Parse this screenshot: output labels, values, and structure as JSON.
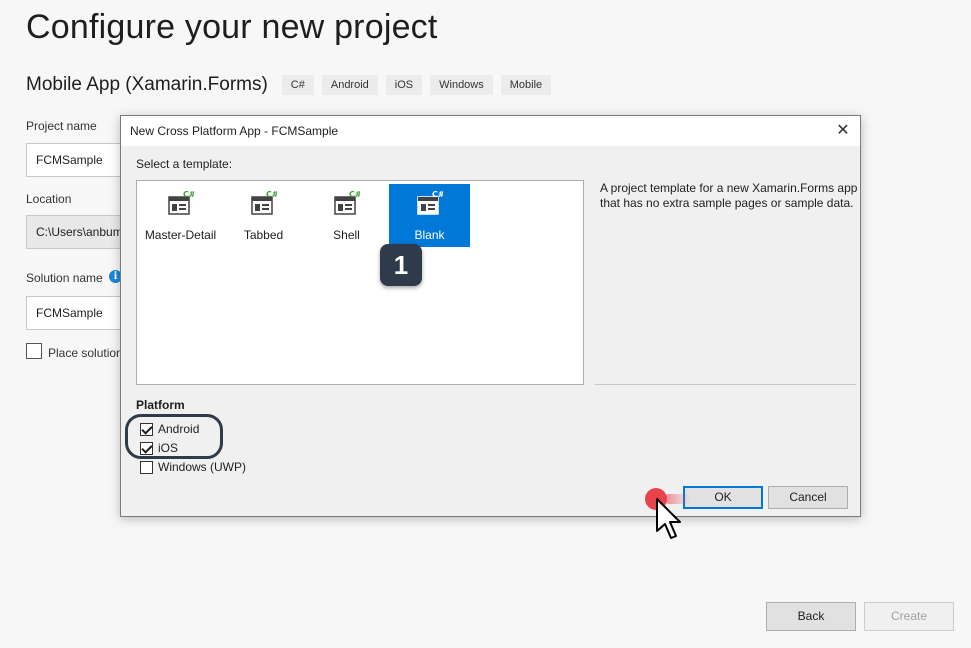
{
  "page": {
    "title": "Configure your new project",
    "subtitle": "Mobile App (Xamarin.Forms)",
    "tags": [
      "C#",
      "Android",
      "iOS",
      "Windows",
      "Mobile"
    ],
    "project_name_label": "Project name",
    "project_name_value": "FCMSample",
    "location_label": "Location",
    "location_value": "C:\\Users\\anbum",
    "solution_name_label": "Solution name",
    "solution_name_value": "FCMSample",
    "info_icon": "i",
    "place_solution_label": "Place solution",
    "back_label": "Back",
    "create_label": "Create"
  },
  "dialog": {
    "title": "New Cross Platform App - FCMSample",
    "close_glyph": "✕",
    "select_template_label": "Select a template:",
    "templates": [
      {
        "label": "Master-Detail",
        "selected": false
      },
      {
        "label": "Tabbed",
        "selected": false
      },
      {
        "label": "Shell",
        "selected": false
      },
      {
        "label": "Blank",
        "selected": true
      }
    ],
    "description": "A project template for a new Xamarin.Forms app that has no extra sample pages or sample data.",
    "platform_heading": "Platform",
    "platforms": [
      {
        "label": "Android",
        "checked": true
      },
      {
        "label": "iOS",
        "checked": true
      },
      {
        "label": "Windows (UWP)",
        "checked": false
      }
    ],
    "ok_label": "OK",
    "cancel_label": "Cancel"
  },
  "annotations": {
    "step_badge": "1",
    "badge_color": "#2f3a4a",
    "click_color": "#e8434a"
  },
  "colors": {
    "selection": "#0078d7",
    "csharp_green": "#3d9c3a"
  }
}
